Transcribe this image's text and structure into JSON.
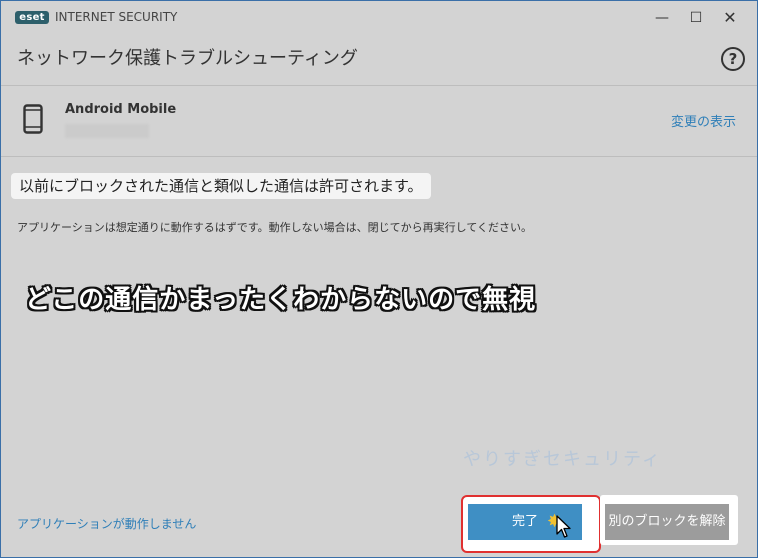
{
  "window": {
    "app_title": "INTERNET SECURITY",
    "logo_text": "eset",
    "min_glyph": "—",
    "max_glyph": "☐",
    "close_glyph": "✕"
  },
  "header": {
    "title": "ネットワーク保護トラブルシューティング",
    "help_glyph": "?"
  },
  "device": {
    "name": "Android Mobile",
    "icon": "smartphone-icon",
    "show_changes_label": "変更の表示"
  },
  "content": {
    "result_message": "以前にブロックされた通信と類似した通信は許可されます。",
    "description": "アプリケーションは想定通りに動作するはずです。動作しない場合は、閉じてから再実行してください。",
    "annotation": "どこの通信かまったくわからないので無視",
    "watermark": "やりすぎセキュリティ"
  },
  "footer": {
    "app_not_working_link": "アプリケーションが動作しません",
    "done_label": "完了",
    "unblock_label": "別のブロックを解除"
  },
  "colors": {
    "background": "#d3d3d3",
    "link": "#2f7fb8",
    "primary_button": "#3f8fc4",
    "secondary_button": "#9c9c9c",
    "highlight_border": "#e03030",
    "logo_bg": "#2d5f6b"
  }
}
